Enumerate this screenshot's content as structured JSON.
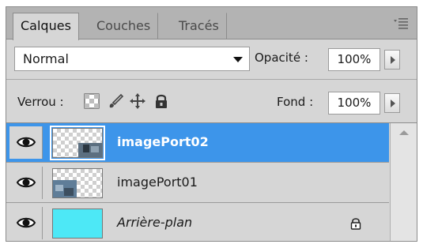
{
  "tabs": [
    {
      "label": "Calques",
      "active": true
    },
    {
      "label": "Couches",
      "active": false
    },
    {
      "label": "Tracés",
      "active": false
    }
  ],
  "blend_mode": {
    "value": "Normal"
  },
  "opacity": {
    "label": "Opacité :",
    "value": "100%"
  },
  "lock": {
    "label": "Verrou :",
    "icons": [
      "lock-transparent-pixels-icon",
      "lock-image-pixels-brush-icon",
      "lock-position-move-icon",
      "lock-all-padlock-icon"
    ]
  },
  "fill": {
    "label": "Fond :",
    "value": "100%"
  },
  "layers": [
    {
      "name": "imagePort02",
      "selected": true,
      "visible": true,
      "thumbnail": "transparent-with-image"
    },
    {
      "name": "imagePort01",
      "selected": false,
      "visible": true,
      "thumbnail": "transparent-with-image"
    },
    {
      "name": "Arrière-plan",
      "selected": false,
      "visible": true,
      "locked": true,
      "thumbnail": "cyan-fill"
    }
  ],
  "colors": {
    "selection": "#3d95ea",
    "background_thumb": "#4de8f6",
    "panel": "#d6d6d6"
  }
}
